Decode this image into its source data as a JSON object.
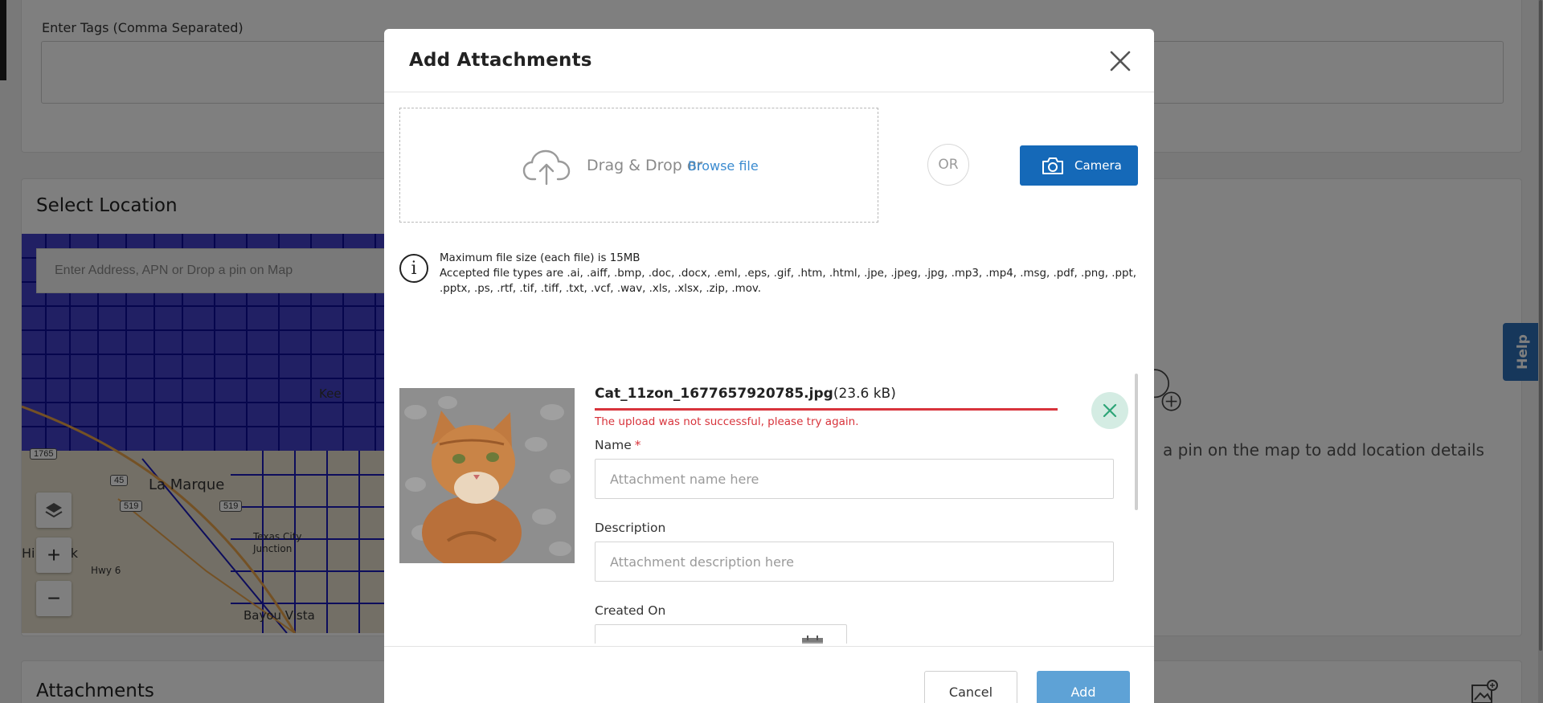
{
  "background": {
    "tags_label": "Enter Tags (Comma Separated)",
    "location_title": "Select Location",
    "map": {
      "search_placeholder": "Enter Address, APN or Drop a pin on Map",
      "place_labels": [
        "La Marque",
        "Hi",
        "ck",
        "Hwy 6",
        "Texas City",
        "Junction",
        "Bayou Vista",
        "Kee"
      ],
      "shields": [
        "1765",
        "45",
        "519",
        "519"
      ],
      "zoom_in": "+",
      "zoom_out": "−"
    },
    "empty_state_text": "a pin on the map to add location details",
    "attachments_title": "Attachments",
    "help_label": "Help"
  },
  "modal": {
    "title": "Add Attachments",
    "dropzone": {
      "text": "Drag & Drop or",
      "link": "Browse file"
    },
    "or_label": "OR",
    "camera_label": "Camera",
    "info": {
      "line1": "Maximum file size (each file) is 15MB",
      "line2": "Accepted file types are .ai, .aiff, .bmp, .doc, .docx, .eml, .eps, .gif, .htm, .html, .jpe, .jpeg, .jpg, .mp3, .mp4, .msg, .pdf, .png, .ppt, .pptx, .ps, .rtf, .tif, .tiff, .txt, .vcf, .wav, .xls, .xlsx, .zip, .mov."
    },
    "file": {
      "name": "Cat_11zon_1677657920785.jpg",
      "size": "(23.6 kB)",
      "error": "The upload was not successful, please try again.",
      "upload_progress": 1.0
    },
    "fields": {
      "name_label": "Name",
      "name_required": "*",
      "name_placeholder": "Attachment name here",
      "description_label": "Description",
      "description_placeholder": "Attachment description here",
      "created_on_label": "Created On"
    },
    "footer": {
      "cancel": "Cancel",
      "add": "Add"
    }
  },
  "colors": {
    "primary": "#1569b8",
    "add_button": "#5ea2d6",
    "error": "#d8343c",
    "remove_button_bg": "#d4ece3",
    "remove_button_icon": "#2ea578",
    "link": "#3b8bd0",
    "map_parcels": "#1010c8"
  }
}
